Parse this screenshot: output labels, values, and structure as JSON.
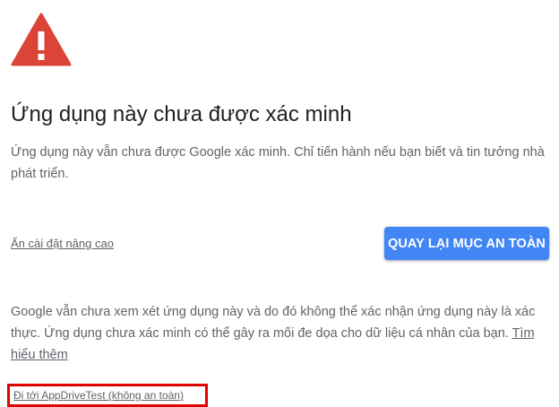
{
  "icon": {
    "name": "warning-triangle-icon",
    "color": "#db4437"
  },
  "title": "Ứng dụng này chưa được xác minh",
  "intro": "Ứng dụng này vẫn chưa được Google xác minh. Chỉ tiến hành nếu bạn biết và tin tưởng nhà phát triển.",
  "hide_advanced_label": "Ẩn cài đặt nâng cao",
  "back_button_label": "QUAY LẠI MỤC AN TOÀN",
  "advanced": {
    "text": "Google vẫn chưa xem xét ứng dụng này và do đó không thể xác nhận ứng dụng này là xác thực. Ứng dụng chưa xác minh có thể gây ra mối đe dọa cho dữ liệu cá nhân của bạn. ",
    "learn_more_label": "Tìm hiểu thêm"
  },
  "proceed_link_label": "Đi tới AppDriveTest (không an toàn)",
  "colors": {
    "accent": "#4285f4",
    "warning": "#db4437",
    "highlight_box": "#e00000"
  }
}
